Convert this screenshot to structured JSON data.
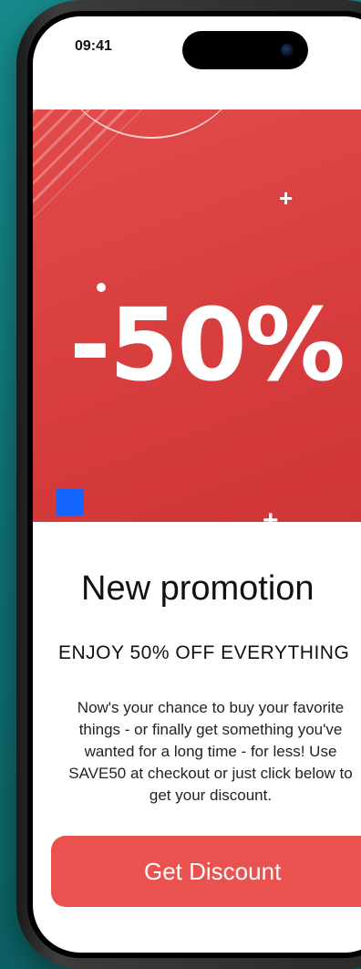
{
  "status_bar": {
    "time": "09:41"
  },
  "promo": {
    "discount": "-50%",
    "title": "New promotion",
    "subtitle": "ENJOY 50% OFF EVERYTHING",
    "body": "Now's your chance to buy your favorite things - or finally get something you've wanted for a long time - for less! Use SAVE50 at checkout or just click below to get your discount.",
    "cta_label": "Get Discount"
  },
  "colors": {
    "background": "#14787b",
    "banner": "#d93e3f",
    "cta": "#e9524f",
    "accent_square": "#1565ff"
  },
  "icons": {
    "decorations": [
      "plus-icon",
      "dot-icon",
      "square-icon"
    ]
  }
}
